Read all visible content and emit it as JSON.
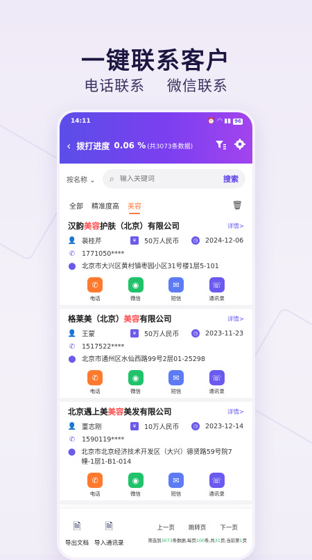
{
  "promo": {
    "title": "一键联系客户",
    "sub1": "电话联系",
    "sub2": "微信联系"
  },
  "status": {
    "time": "14:11",
    "battery": "96"
  },
  "nav": {
    "title": "拨打进度",
    "percent": "0.06 %",
    "count": "(共3073条数据)"
  },
  "search": {
    "by": "按名称 ⌄",
    "placeholder": "输入关键词",
    "button": "搜索"
  },
  "tabs": [
    "全部",
    "精准度高",
    "美容"
  ],
  "actions": {
    "call": "电话",
    "wechat": "微信",
    "sms": "短信",
    "contacts": "通讯录"
  },
  "detail_label": "详情>",
  "companies": [
    {
      "name_pre": "汉韵",
      "name_hl": "美容",
      "name_post": "护肤（北京）有限公司",
      "person": "裴桂芹",
      "capital": "50万人民币",
      "date": "2024-12-06",
      "phone": "1771050****",
      "address": "北京市大兴区黄村镇枣园小区31号楼1层5-101"
    },
    {
      "name_pre": "格莱美（北京）",
      "name_hl": "美容",
      "name_post": "有限公司",
      "person": "王蒙",
      "capital": "50万人民币",
      "date": "2023-11-23",
      "phone": "1517522****",
      "address": "北京市通州区水仙西路99号2层01-25298"
    },
    {
      "name_pre": "北京遇上美",
      "name_hl": "美容",
      "name_post": "美发有限公司",
      "person": "董志刚",
      "capital": "10万人民币",
      "date": "2023-12-14",
      "phone": "1590119****",
      "address": "北京市北京经济技术开发区（大兴）德贤路59号院7幢-1层1-B1-014"
    }
  ],
  "footer": {
    "export": "导出文档",
    "import": "导入通讯录",
    "prev": "上一页",
    "jump": "跳转页",
    "next": "下一页",
    "info_a": "筛选到",
    "total": "3073",
    "info_b": "条数据,每页",
    "per_page": "100",
    "info_c": "条,共",
    "pages": "31",
    "info_d": "页,当前第",
    "current": "1",
    "info_e": "页"
  }
}
